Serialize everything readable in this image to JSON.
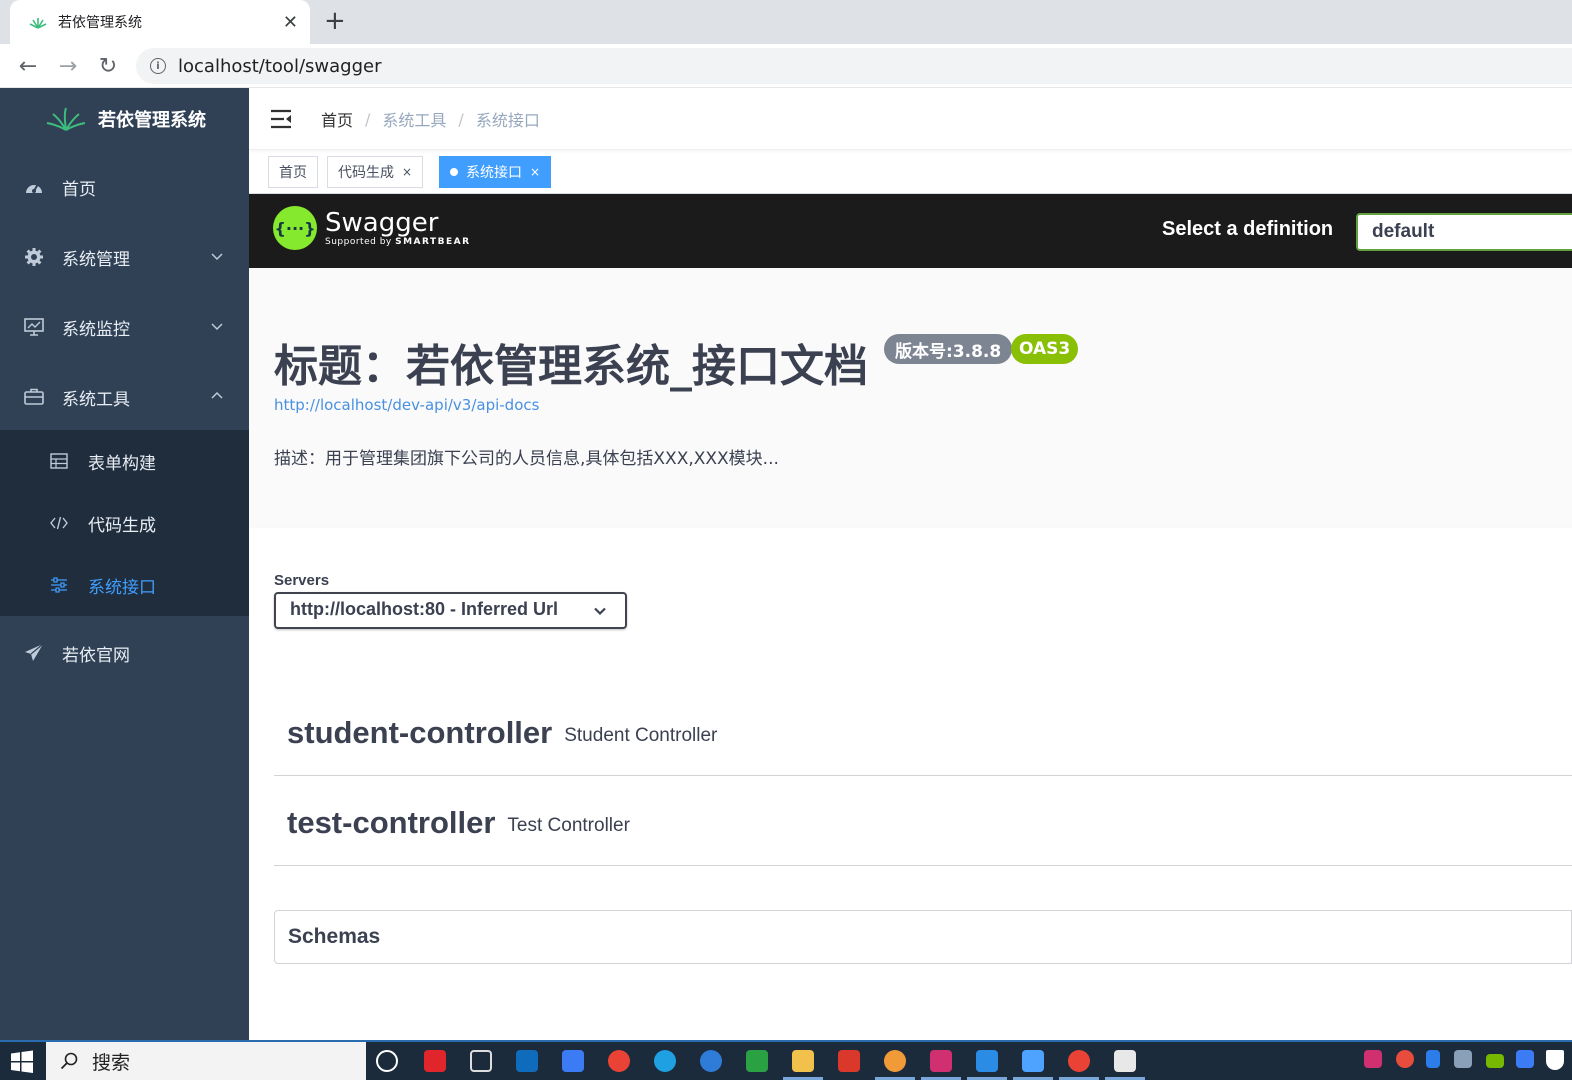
{
  "browser": {
    "tab_title": "若依管理系统",
    "close_glyph": "✕",
    "new_tab_glyph": "+",
    "url": "localhost/tool/swagger",
    "back_glyph": "←",
    "forward_glyph": "→",
    "reload_glyph": "↻",
    "info_glyph": "i"
  },
  "sidebar": {
    "logo_text": "若依管理系统",
    "menu": [
      {
        "label": "首页",
        "icon": "dashboard-icon"
      },
      {
        "label": "系统管理",
        "icon": "gear-icon"
      },
      {
        "label": "系统监控",
        "icon": "monitor-icon"
      },
      {
        "label": "系统工具",
        "icon": "toolbox-icon"
      },
      {
        "label": "若依官网",
        "icon": "paper-plane-icon"
      }
    ],
    "submenu": [
      {
        "label": "表单构建",
        "icon": "table-icon"
      },
      {
        "label": "代码生成",
        "icon": "code-icon"
      },
      {
        "label": "系统接口",
        "icon": "sliders-icon",
        "active": true
      }
    ],
    "bg_color": "#304156",
    "active_color": "#409eff"
  },
  "navbar": {
    "breadcrumb": [
      "首页",
      "系统工具",
      "系统接口"
    ],
    "separator": "/"
  },
  "tags": [
    {
      "label": "首页"
    },
    {
      "label": "代码生成",
      "close": "×"
    },
    {
      "label": "系统接口",
      "close": "×",
      "active": true
    }
  ],
  "swagger": {
    "logo_glyph": "{···}",
    "name": "Swagger",
    "supported_by": "Supported by",
    "smartbear": "SMARTBEAR",
    "definition_label": "Select a definition",
    "definition_value": "default",
    "title": "标题：若依管理系统_接口文档",
    "version_badge": "版本号:3.8.8",
    "oas_badge": "OAS3",
    "url": "http://localhost/dev-api/v3/api-docs",
    "description": "描述：用于管理集团旗下公司的人员信息,具体包括XXX,XXX模块...",
    "servers_label": "Servers",
    "server_value": "http://localhost:80 - Inferred Url",
    "controllers": [
      {
        "name": "student-controller",
        "description": "Student Controller"
      },
      {
        "name": "test-controller",
        "description": "Test Controller"
      }
    ],
    "schemas_label": "Schemas"
  },
  "taskbar": {
    "search_placeholder": "搜索"
  }
}
